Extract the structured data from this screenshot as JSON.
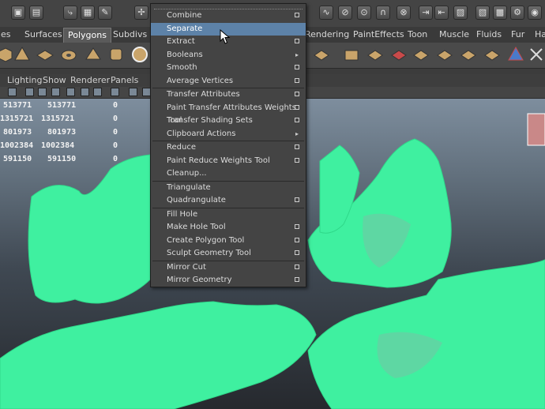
{
  "toolbar": {
    "icons": [
      "folder-icon",
      "save-icon",
      "lasso-icon",
      "select-icon",
      "paint-icon",
      "snap-icon",
      "magnet-icon",
      "render-icon",
      "camera-icon"
    ]
  },
  "tabs": [
    "es",
    "Surfaces",
    "Polygons",
    "Subdivs",
    "Rendering",
    "PaintEffects",
    "Toon",
    "Muscle",
    "Fluids",
    "Fur",
    "Ha"
  ],
  "active_tab": "Polygons",
  "panel_menu": [
    "Lighting",
    "Show",
    "Renderer",
    "Panels"
  ],
  "hud": [
    [
      "513771",
      "513771",
      "0"
    ],
    [
      "1315721",
      "1315721",
      "0"
    ],
    [
      "801973",
      "801973",
      "0"
    ],
    [
      "1002384",
      "1002384",
      "0"
    ],
    [
      "591150",
      "591150",
      "0"
    ]
  ],
  "menu": {
    "groups": [
      [
        {
          "label": "Combine",
          "option": true
        },
        {
          "label": "Separate",
          "option": false,
          "selected": true
        },
        {
          "label": "Extract",
          "option": true
        },
        {
          "label": "Booleans",
          "submenu": true
        },
        {
          "label": "Smooth",
          "option": true
        },
        {
          "label": "Average Vertices",
          "option": true
        }
      ],
      [
        {
          "label": "Transfer Attributes",
          "option": true
        },
        {
          "label": "Paint Transfer Attributes Weights Tool",
          "option": true
        },
        {
          "label": "Transfer Shading Sets",
          "option": true
        },
        {
          "label": "Clipboard Actions",
          "submenu": true
        }
      ],
      [
        {
          "label": "Reduce",
          "option": true
        },
        {
          "label": "Paint Reduce Weights Tool",
          "option": true
        },
        {
          "label": "Cleanup...",
          "option": false
        }
      ],
      [
        {
          "label": "Triangulate",
          "option": false
        },
        {
          "label": "Quadrangulate",
          "option": true
        }
      ],
      [
        {
          "label": "Fill Hole",
          "option": false
        },
        {
          "label": "Make Hole Tool",
          "option": true
        },
        {
          "label": "Create Polygon Tool",
          "option": true
        },
        {
          "label": "Sculpt Geometry Tool",
          "option": true
        }
      ],
      [
        {
          "label": "Mirror Cut",
          "option": true
        },
        {
          "label": "Mirror Geometry",
          "option": true
        }
      ]
    ]
  },
  "colors": {
    "mesh": "#3ff0a0",
    "highlight": "#5d82a8"
  }
}
